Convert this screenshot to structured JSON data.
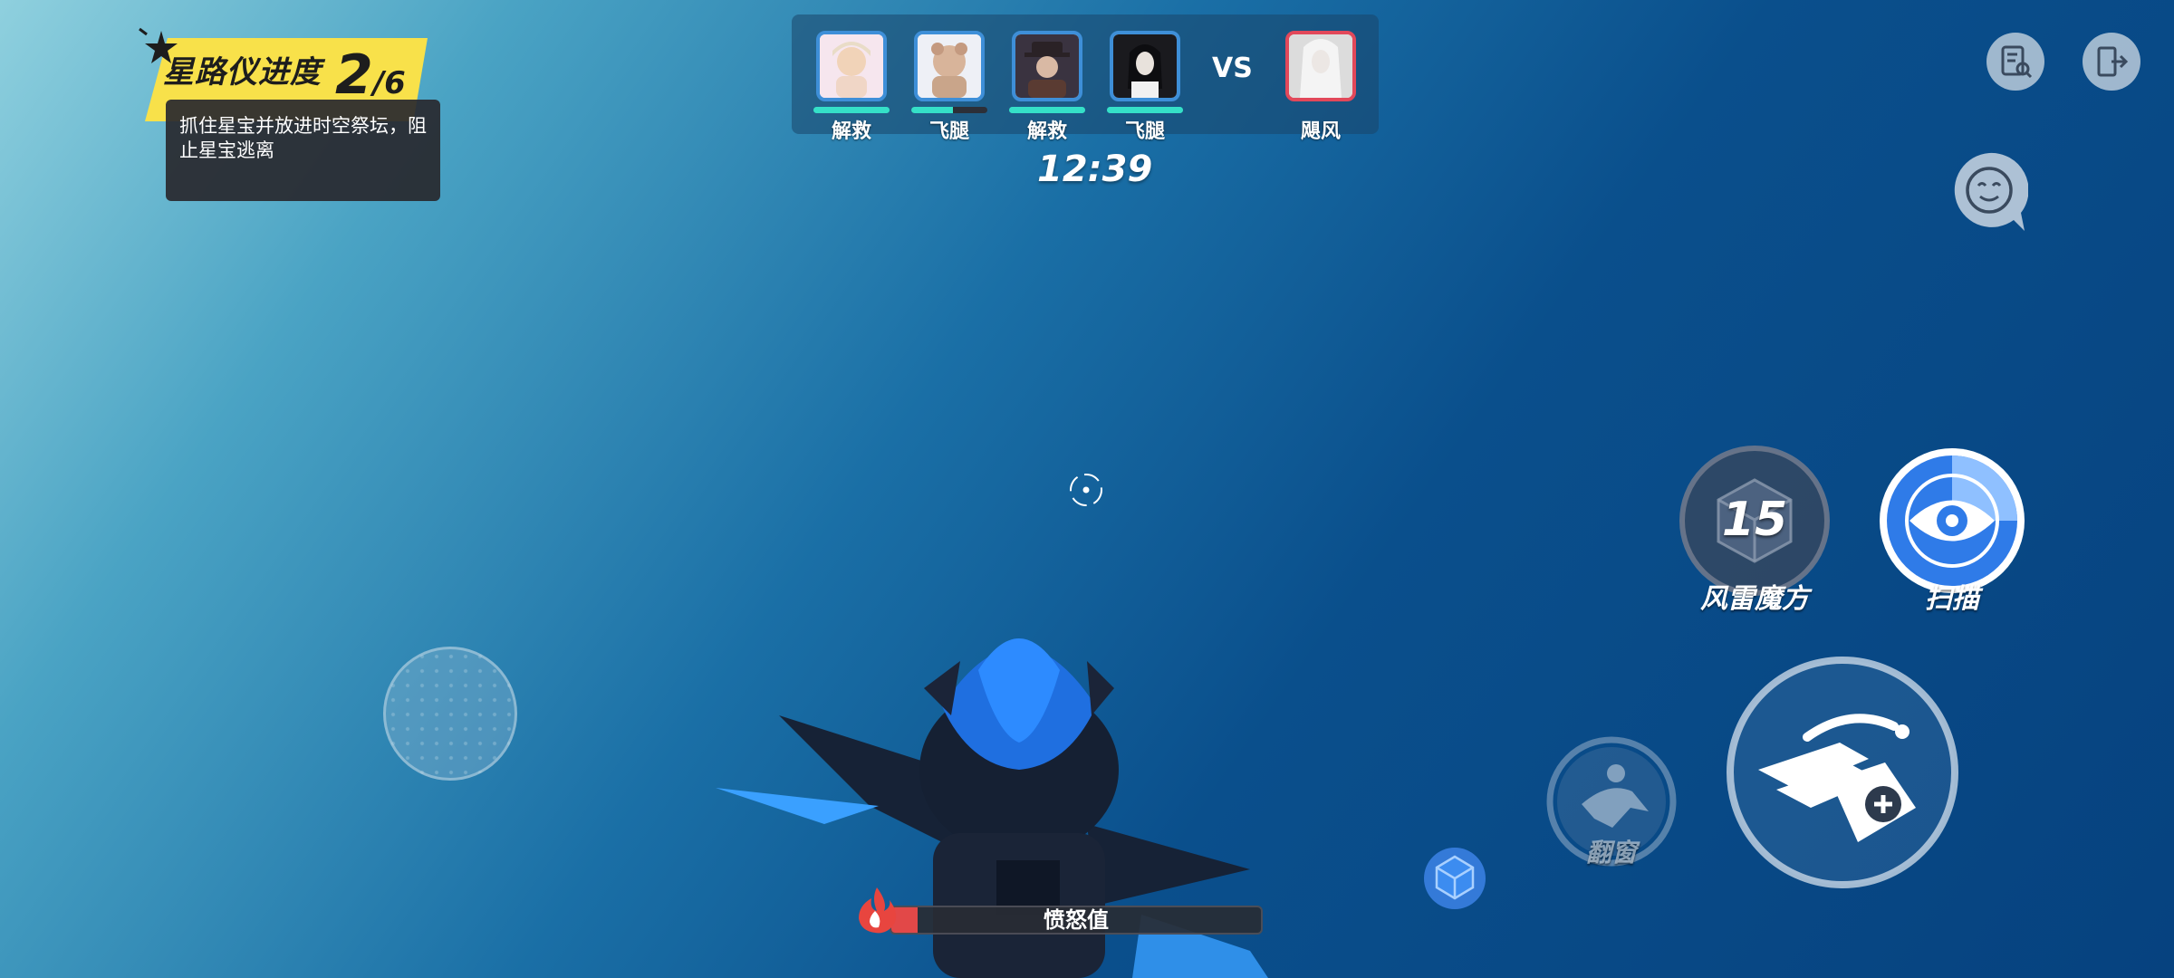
{
  "quest": {
    "title": "星路仪进度",
    "progress_current": "2",
    "progress_sep_total": "/6",
    "description": "抓住星宝并放进时空祭坛，阻止星宝逃离"
  },
  "scoreboard": {
    "team": [
      {
        "label": "解救",
        "hp": 1.0
      },
      {
        "label": "飞腿",
        "hp": 0.55
      },
      {
        "label": "解救",
        "hp": 1.0
      },
      {
        "label": "飞腿",
        "hp": 1.0
      }
    ],
    "vs_text": "VS",
    "enemy": {
      "label": "飓风"
    }
  },
  "timer": "12:39",
  "skills": {
    "cube": {
      "label": "风雷魔方",
      "cooldown": "15"
    },
    "scan": {
      "label": "扫描"
    },
    "window": {
      "label": "翻窗"
    }
  },
  "rage": {
    "label": "愤怒值",
    "fill": 0.07
  },
  "colors": {
    "ally_border": "#3e8fd8",
    "enemy_border": "#e2485a",
    "hp": "#35e0c8",
    "quest_banner": "#f8e14a",
    "rage_fill": "#e24848"
  },
  "icons": {
    "top_right": [
      "task-list-icon",
      "exit-door-icon"
    ],
    "chat": "emoji-chat-icon"
  }
}
